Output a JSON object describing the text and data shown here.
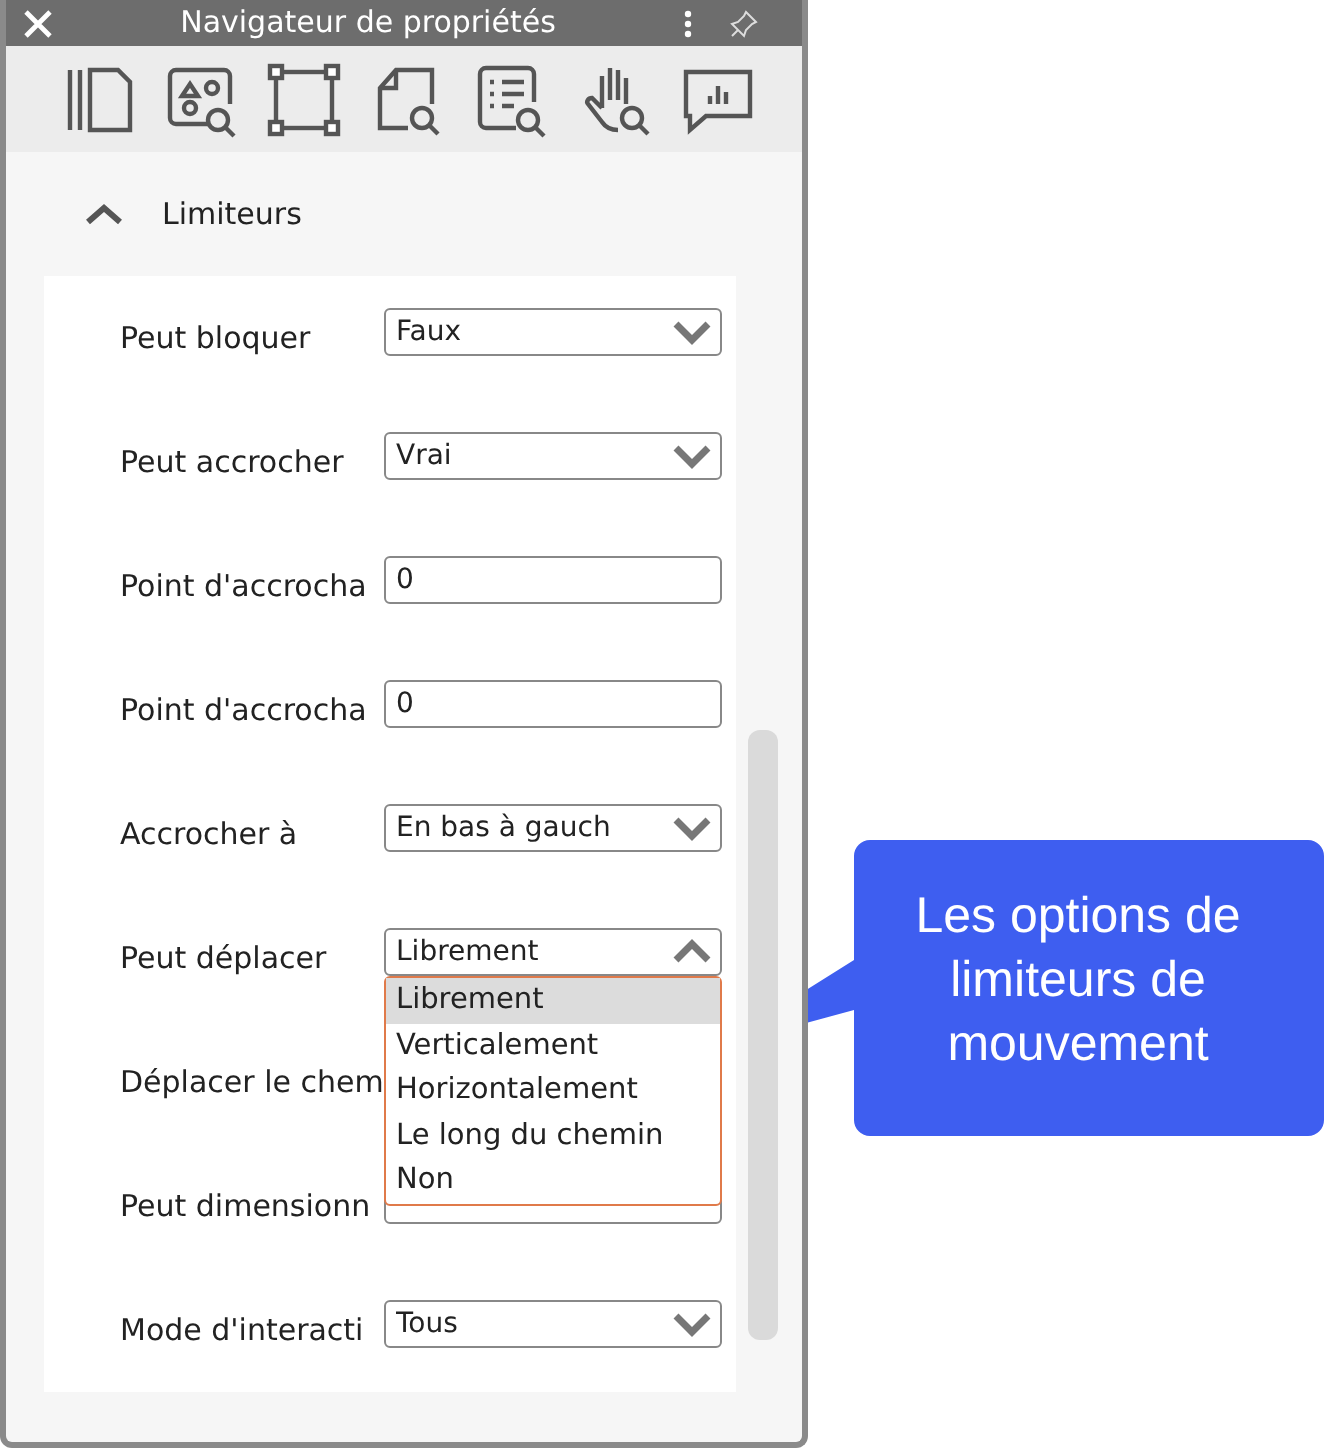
{
  "window": {
    "title": "Navigateur de propriétés"
  },
  "section": {
    "title": "Limiteurs",
    "expanded": true
  },
  "properties": [
    {
      "label": "Peut bloquer",
      "kind": "select",
      "value": "Faux",
      "expanded": false
    },
    {
      "label": "Peut accrocher",
      "kind": "select",
      "value": "Vrai",
      "expanded": false
    },
    {
      "label": "Point d'accrocha",
      "kind": "input",
      "value": "0"
    },
    {
      "label": "Point d'accrocha",
      "kind": "input",
      "value": "0"
    },
    {
      "label": "Accrocher à",
      "kind": "select",
      "value": "En bas à gauch",
      "expanded": false
    },
    {
      "label": "Peut déplacer",
      "kind": "select",
      "value": "Librement",
      "expanded": true,
      "options": [
        {
          "label": "Librement",
          "selected": true
        },
        {
          "label": "Verticalement",
          "selected": false
        },
        {
          "label": "Horizontalement",
          "selected": false
        },
        {
          "label": "Le long du chemin",
          "selected": false
        },
        {
          "label": "Non",
          "selected": false
        }
      ]
    },
    {
      "label": "Déplacer le chem",
      "kind": "select"
    },
    {
      "label": "Peut dimensionn",
      "kind": "select"
    },
    {
      "label": "Mode d'interacti",
      "kind": "select",
      "value": "Tous",
      "expanded": false
    }
  ],
  "callout": {
    "text": "Les options de limiteurs de mouvement"
  }
}
